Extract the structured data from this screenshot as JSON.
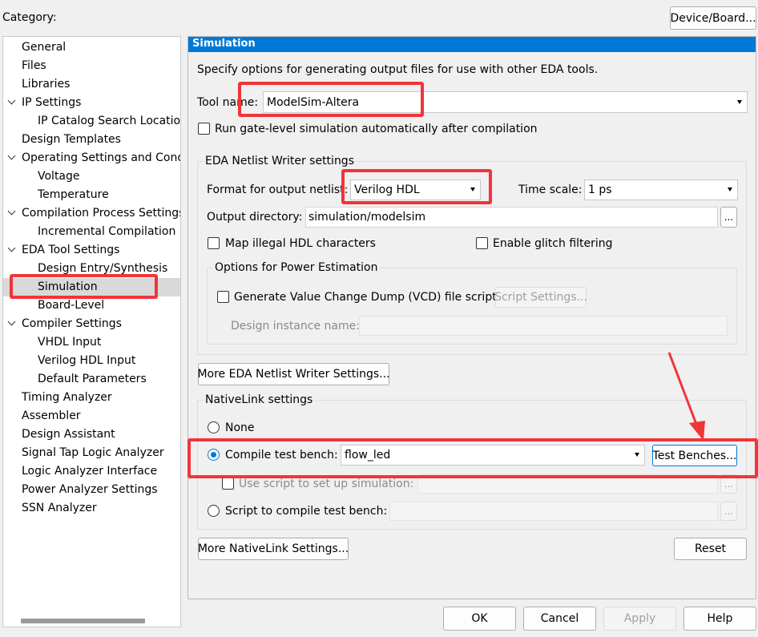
{
  "header": {
    "category_label": "Category:",
    "device_board_button": "Device/Board..."
  },
  "tree": {
    "items": [
      {
        "label": "General",
        "level": 0,
        "expandable": false
      },
      {
        "label": "Files",
        "level": 0,
        "expandable": false
      },
      {
        "label": "Libraries",
        "level": 0,
        "expandable": false
      },
      {
        "label": "IP Settings",
        "level": 0,
        "expandable": true
      },
      {
        "label": "IP Catalog Search Location",
        "level": 1,
        "expandable": false
      },
      {
        "label": "Design Templates",
        "level": 0,
        "expandable": false
      },
      {
        "label": "Operating Settings and Conditions",
        "level": 0,
        "expandable": true
      },
      {
        "label": "Voltage",
        "level": 1,
        "expandable": false
      },
      {
        "label": "Temperature",
        "level": 1,
        "expandable": false
      },
      {
        "label": "Compilation Process Settings",
        "level": 0,
        "expandable": true
      },
      {
        "label": "Incremental Compilation",
        "level": 1,
        "expandable": false
      },
      {
        "label": "EDA Tool Settings",
        "level": 0,
        "expandable": true
      },
      {
        "label": "Design Entry/Synthesis",
        "level": 1,
        "expandable": false
      },
      {
        "label": "Simulation",
        "level": 1,
        "expandable": false,
        "selected": true
      },
      {
        "label": "Board-Level",
        "level": 1,
        "expandable": false
      },
      {
        "label": "Compiler Settings",
        "level": 0,
        "expandable": true
      },
      {
        "label": "VHDL Input",
        "level": 1,
        "expandable": false
      },
      {
        "label": "Verilog HDL Input",
        "level": 1,
        "expandable": false
      },
      {
        "label": "Default Parameters",
        "level": 1,
        "expandable": false
      },
      {
        "label": "Timing Analyzer",
        "level": 0,
        "expandable": false
      },
      {
        "label": "Assembler",
        "level": 0,
        "expandable": false
      },
      {
        "label": "Design Assistant",
        "level": 0,
        "expandable": false
      },
      {
        "label": "Signal Tap Logic Analyzer",
        "level": 0,
        "expandable": false
      },
      {
        "label": "Logic Analyzer Interface",
        "level": 0,
        "expandable": false
      },
      {
        "label": "Power Analyzer Settings",
        "level": 0,
        "expandable": false
      },
      {
        "label": "SSN Analyzer",
        "level": 0,
        "expandable": false
      }
    ]
  },
  "panel": {
    "title": "Simulation",
    "description": "Specify options for generating output files for use with other EDA tools.",
    "tool_name_label": "Tool name:",
    "tool_name_value": "ModelSim-Altera",
    "run_gate_level_label": "Run gate-level simulation automatically after compilation",
    "netlist": {
      "group_title": "EDA Netlist Writer settings",
      "format_label": "Format for output netlist:",
      "format_value": "Verilog HDL",
      "time_scale_label": "Time scale:",
      "time_scale_value": "1 ps",
      "output_dir_label": "Output directory:",
      "output_dir_value": "simulation/modelsim",
      "browse_label": "...",
      "map_illegal_label": "Map illegal HDL characters",
      "glitch_label": "Enable glitch filtering",
      "power": {
        "group_title": "Options for Power Estimation",
        "vcd_label": "Generate Value Change Dump (VCD) file script",
        "script_settings_button": "Script Settings...",
        "instance_label": "Design instance name:"
      },
      "more_button": "More EDA Netlist Writer Settings..."
    },
    "nativelink": {
      "group_title": "NativeLink settings",
      "none_label": "None",
      "compile_tb_label": "Compile test bench:",
      "compile_tb_value": "flow_led",
      "test_benches_button": "Test Benches...",
      "use_script_label": "Use script to set up simulation:",
      "script_compile_label": "Script to compile test bench:",
      "browse_label": "...",
      "more_button": "More NativeLink Settings...",
      "reset_button": "Reset"
    }
  },
  "footer": {
    "ok": "OK",
    "cancel": "Cancel",
    "apply": "Apply",
    "help": "Help"
  },
  "colors": {
    "accent": "#0078d7",
    "annotation_red": "#f0353a"
  }
}
